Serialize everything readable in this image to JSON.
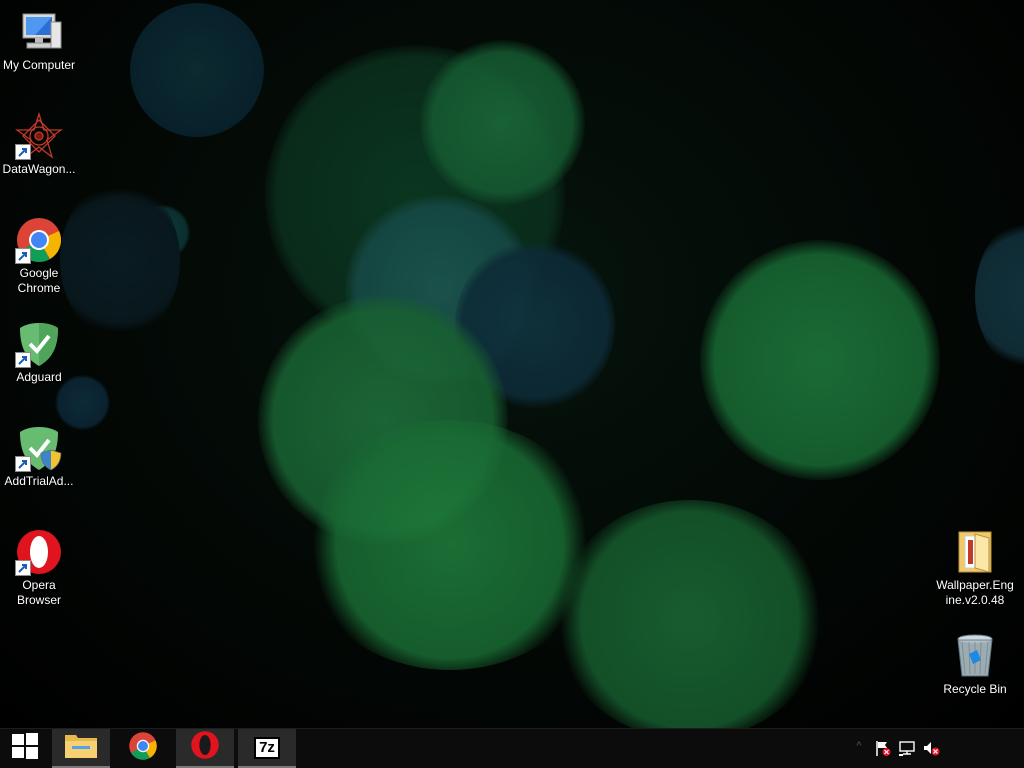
{
  "desktop": {
    "icons": [
      {
        "label": "My Computer",
        "icon": "computer-icon"
      },
      {
        "label": "DataWagon...",
        "icon": "datawagon-icon"
      },
      {
        "label": "Google Chrome",
        "icon": "chrome-icon"
      },
      {
        "label": "Adguard",
        "icon": "adguard-icon"
      },
      {
        "label": "AddTrialAd...",
        "icon": "adguard-shield-uac-icon"
      },
      {
        "label": "Opera Browser",
        "icon": "opera-icon"
      },
      {
        "label": "Wallpaper.Engine.v2.0.48",
        "icon": "folder-icon"
      },
      {
        "label": "Recycle Bin",
        "icon": "recycle-bin-icon"
      }
    ]
  },
  "taskbar": {
    "buttons": [
      {
        "name": "start",
        "icon": "windows-logo-icon"
      },
      {
        "name": "file-explorer",
        "icon": "file-explorer-icon"
      },
      {
        "name": "chrome",
        "icon": "chrome-icon"
      },
      {
        "name": "opera",
        "icon": "opera-icon"
      },
      {
        "name": "7-zip",
        "icon": "7zip-icon"
      }
    ],
    "tray": {
      "overflow_chevron": "^",
      "icons": [
        "action-center-flag-icon",
        "network-icon",
        "volume-muted-icon"
      ]
    },
    "sevenzip_text": "7z"
  },
  "colors": {
    "wallpaper_green": "#1f7a3c",
    "wallpaper_teal": "#1a4a55",
    "taskbar": "#0c0c0c",
    "opera_red": "#e0141e"
  }
}
